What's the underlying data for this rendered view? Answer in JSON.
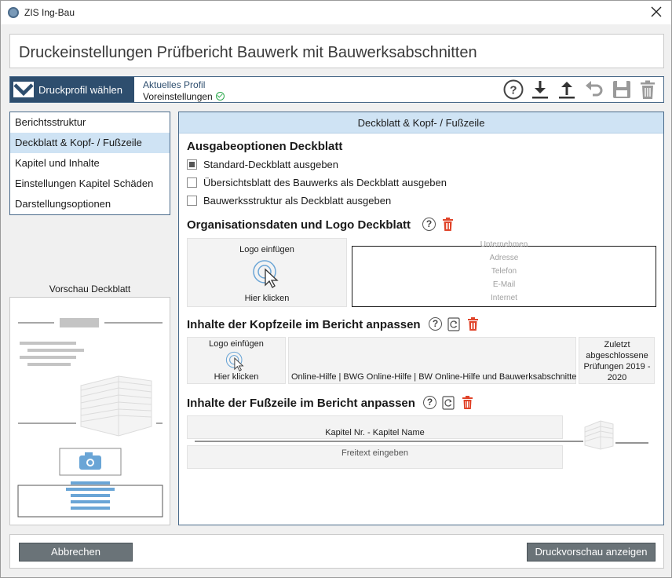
{
  "window": {
    "title": "ZIS Ing-Bau"
  },
  "header": {
    "title": "Druckeinstellungen Prüfbericht Bauwerk mit Bauwerksabschnitten"
  },
  "profile": {
    "button_label": "Druckprofil wählen",
    "current_label": "Aktuelles Profil",
    "current_value": "Voreinstellungen"
  },
  "nav": {
    "items": [
      {
        "label": "Berichtsstruktur"
      },
      {
        "label": "Deckblatt & Kopf- / Fußzeile"
      },
      {
        "label": "Kapitel und Inhalte"
      },
      {
        "label": "Einstellungen Kapitel Schäden"
      },
      {
        "label": "Darstellungsoptionen"
      }
    ],
    "active_index": 1
  },
  "preview": {
    "label": "Vorschau Deckblatt"
  },
  "main": {
    "tab_title": "Deckblatt & Kopf- / Fußzeile",
    "cover_options": {
      "title": "Ausgabeoptionen Deckblatt",
      "options": [
        {
          "label": "Standard-Deckblatt ausgeben",
          "checked": true
        },
        {
          "label": "Übersichtsblatt des Bauwerks als Deckblatt ausgeben",
          "checked": false
        },
        {
          "label": "Bauwerksstruktur als Deckblatt ausgeben",
          "checked": false
        }
      ]
    },
    "org": {
      "title": "Organisationsdaten und Logo Deckblatt",
      "logo_insert": "Logo einfügen",
      "logo_click": "Hier klicken",
      "fields": [
        "Unternehmen",
        "Adresse",
        "Telefon",
        "E-Mail",
        "Internet"
      ]
    },
    "header_section": {
      "title": "Inhalte der Kopfzeile im Bericht anpassen",
      "logo_insert": "Logo einfügen",
      "logo_click": "Hier klicken",
      "middle_text": "Online-Hilfe | BWG Online-Hilfe | BW Online-Hilfe und Bauwerksabschnitte",
      "right_text": "Zuletzt abgeschlossene Prüfungen 2019 - 2020"
    },
    "footer_section": {
      "title": "Inhalte der Fußzeile im Bericht anpassen",
      "chapter_text": "Kapitel Nr. - Kapitel Name",
      "freetext_placeholder": "Freitext eingeben"
    }
  },
  "buttons": {
    "cancel": "Abbrechen",
    "preview": "Druckvorschau anzeigen"
  },
  "colors": {
    "accent": "#2e4e6e",
    "selection": "#cfe3f4",
    "trash": "#e0442a",
    "ok": "#2aa84a"
  }
}
